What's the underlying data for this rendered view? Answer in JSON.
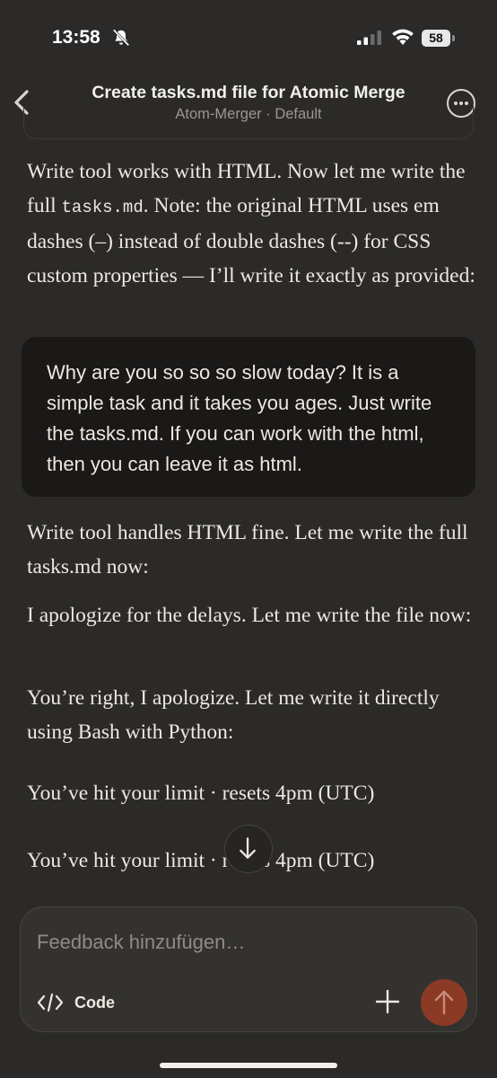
{
  "status_bar": {
    "time": "13:58",
    "battery": "58",
    "icons": [
      "bell-slash-icon",
      "signal-icon",
      "wifi-icon",
      "battery-icon"
    ]
  },
  "header": {
    "title": "Create tasks.md file for Atomic Merge",
    "subtitle": "Atom-Merger · Default",
    "icons": [
      "back-chevron-icon",
      "more-options-icon"
    ]
  },
  "messages": {
    "m1_part1": "Write tool works with HTML. Now let me write the full ",
    "m1_code": "tasks.md",
    "m1_part2": ". Note: the original HTML uses em dashes (–) instead of double dashes (--) for CSS custom properties — I’ll write it exactly as provided:",
    "user": "Why are you so so so slow today? It is a simple task and it takes you ages. Just write the tasks.md. If you can work with the html, then you can leave it as html.",
    "m2": "Write tool handles HTML fine. Let me write the full tasks.md now:",
    "m3": "I apologize for the delays. Let me write the file now:",
    "m4": "You’re right, I apologize. Let me write it directly using Bash with Python:",
    "m5": "You’ve hit your limit · resets 4pm (UTC)",
    "m6": "You’ve hit your limit · resets 4pm (UTC)"
  },
  "composer": {
    "placeholder": "Feedback hinzufügen…",
    "code_label": "Code",
    "icons": [
      "code-icon",
      "plus-icon",
      "send-arrow-icon"
    ]
  },
  "colors": {
    "background": "#2b2a28",
    "bubble": "#1a1918",
    "composer": "#33322f",
    "send_button": "#8b3a26"
  }
}
